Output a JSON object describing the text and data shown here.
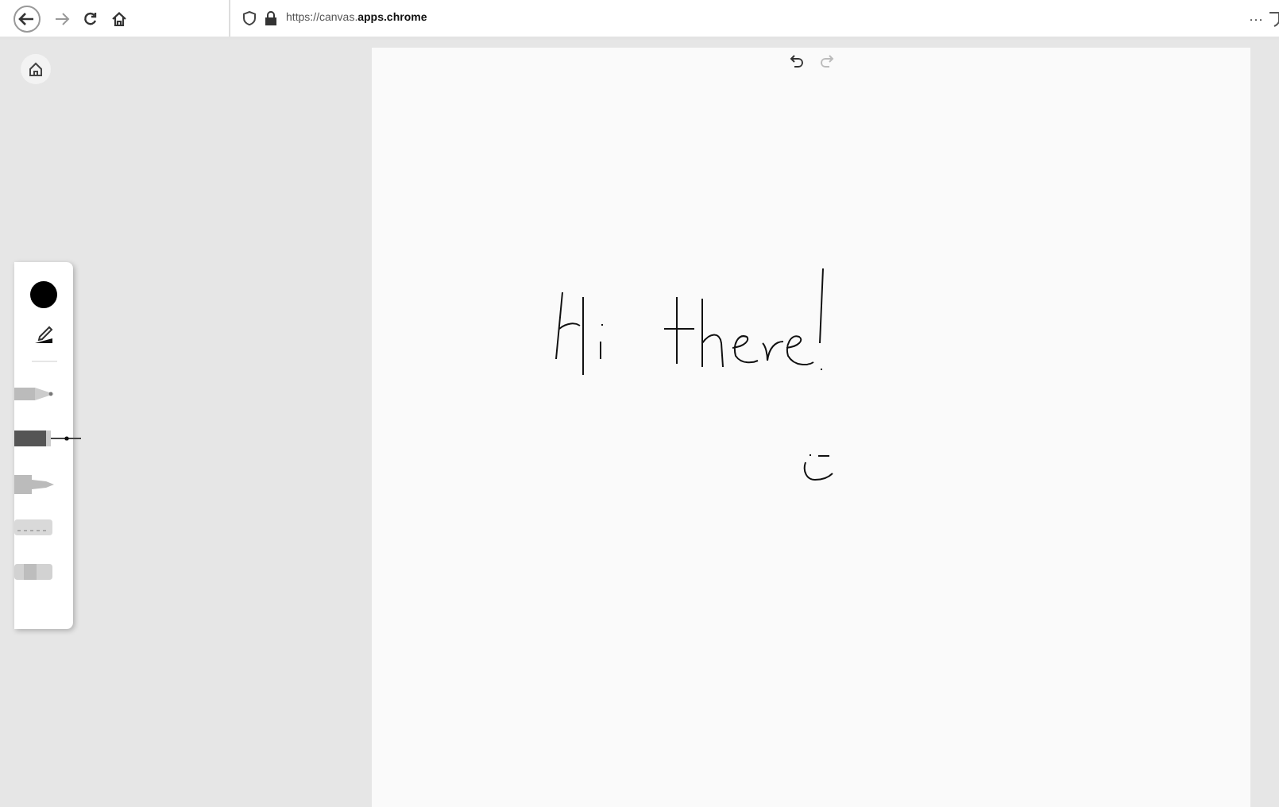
{
  "browser": {
    "url": "https://canvas.**apps.chrome**",
    "menu": "···"
  },
  "history": {
    "undo_enabled": true,
    "redo_enabled": false
  },
  "palette": {
    "color": "#000000",
    "tools": [
      {
        "kind": "pencil",
        "selected": false
      },
      {
        "kind": "pen",
        "selected": true
      },
      {
        "kind": "marker",
        "selected": false
      },
      {
        "kind": "highlighter",
        "selected": false
      },
      {
        "kind": "eraser",
        "selected": false
      }
    ]
  }
}
